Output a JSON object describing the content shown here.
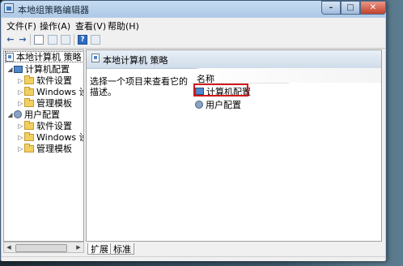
{
  "window": {
    "title": "本地组策略编辑器"
  },
  "titlebar_buttons": {
    "minimize": "–",
    "maximize": "□",
    "close": "✕"
  },
  "menu": [
    {
      "label": "文件(F)"
    },
    {
      "label": "操作(A)"
    },
    {
      "label": "查看(V)"
    },
    {
      "label": "帮助(H)"
    }
  ],
  "toolbar": {
    "back_icon": "←",
    "forward_icon": "→",
    "help_icon": "?"
  },
  "tree": {
    "root": "本地计算机 策略",
    "items": [
      {
        "label": "计算机配置",
        "icon": "computer-icon",
        "expander": "◢"
      },
      {
        "label": "软件设置",
        "icon": "folder-icon",
        "expander": "▷"
      },
      {
        "label": "Windows 设",
        "icon": "folder-icon",
        "expander": "▷"
      },
      {
        "label": "管理模板",
        "icon": "folder-icon",
        "expander": "▷"
      },
      {
        "label": "用户配置",
        "icon": "user-icon",
        "expander": "◢"
      },
      {
        "label": "软件设置",
        "icon": "folder-icon",
        "expander": "▷"
      },
      {
        "label": "Windows 设",
        "icon": "folder-icon",
        "expander": "▷"
      },
      {
        "label": "管理模板",
        "icon": "folder-icon",
        "expander": "▷"
      }
    ],
    "scroll_left": "◀",
    "scroll_right": "▶"
  },
  "content": {
    "header_title": "本地计算机 策略",
    "description": "选择一个项目来查看它的描述。",
    "column_header": "名称",
    "rows": [
      {
        "label": "计算机配置",
        "icon": "computer-icon",
        "highlighted": true
      },
      {
        "label": "用户配置",
        "icon": "user-icon",
        "highlighted": false
      }
    ],
    "highlight_color": "#d21818"
  },
  "tabs": [
    {
      "label": "扩展",
      "active": true
    },
    {
      "label": "标准",
      "active": false
    }
  ]
}
